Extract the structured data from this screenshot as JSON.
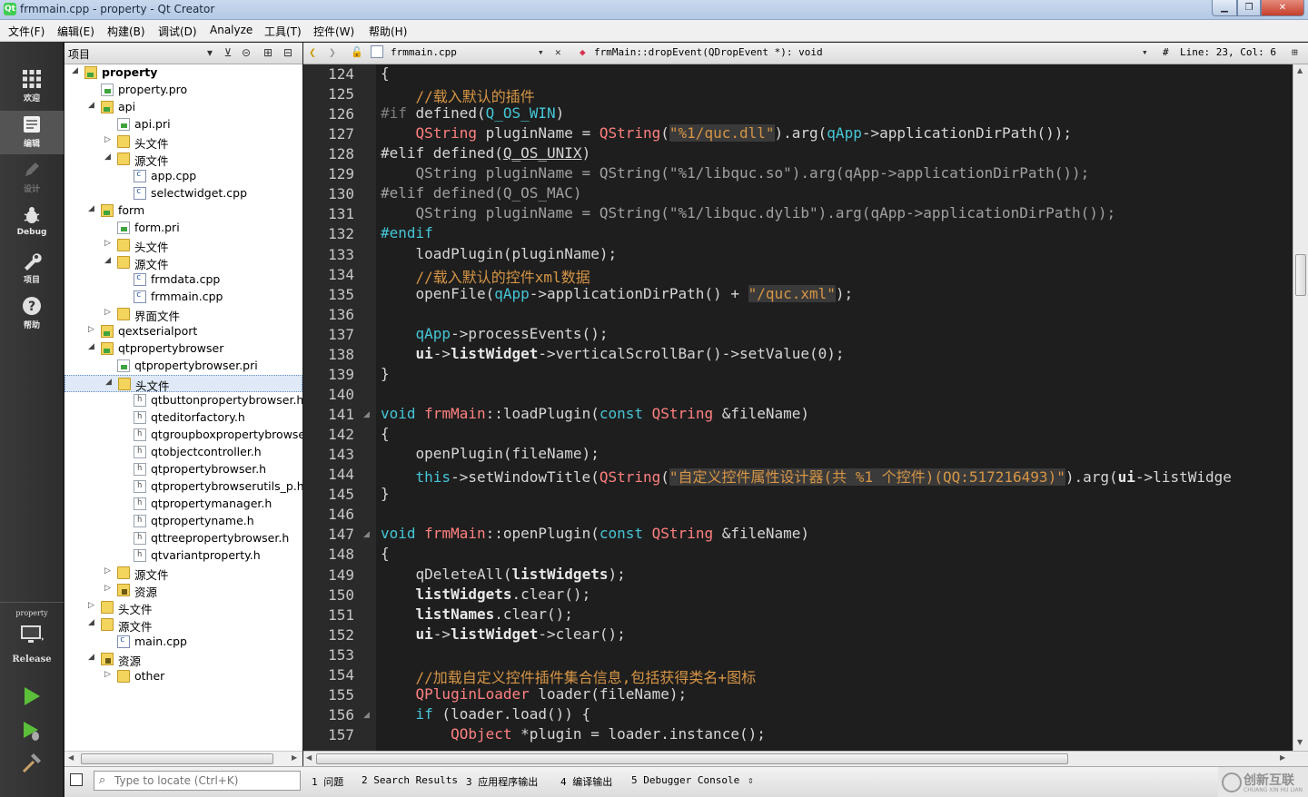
{
  "window": {
    "title": "frmmain.cpp - property - Qt Creator",
    "minimize": "▁",
    "maximize": "❐",
    "close": "✕"
  },
  "menu": [
    "文件(F)",
    "编辑(E)",
    "构建(B)",
    "调试(D)",
    "Analyze",
    "工具(T)",
    "控件(W)",
    "帮助(H)"
  ],
  "modes": [
    {
      "label": "欢迎",
      "icon": "grid-icon"
    },
    {
      "label": "编辑",
      "icon": "edit-icon"
    },
    {
      "label": "设计",
      "icon": "pencil-icon"
    },
    {
      "label": "Debug",
      "icon": "bug-icon"
    },
    {
      "label": "项目",
      "icon": "wrench-icon"
    },
    {
      "label": "帮助",
      "icon": "help-icon"
    }
  ],
  "kit": {
    "project": "property",
    "config": "Release"
  },
  "project_panel": {
    "title": "项目"
  },
  "tree": [
    {
      "label": "property",
      "icon": "projfolder",
      "depth": 0,
      "tw": "◢",
      "bold": true
    },
    {
      "label": "property.pro",
      "icon": "pro",
      "depth": 1,
      "tw": ""
    },
    {
      "label": "api",
      "icon": "projfolder",
      "depth": 1,
      "tw": "◢"
    },
    {
      "label": "api.pri",
      "icon": "pro",
      "depth": 2,
      "tw": ""
    },
    {
      "label": "头文件",
      "icon": "folder",
      "depth": 2,
      "tw": "▷"
    },
    {
      "label": "源文件",
      "icon": "folder",
      "depth": 2,
      "tw": "◢"
    },
    {
      "label": "app.cpp",
      "icon": "cfile",
      "depth": 3,
      "tw": ""
    },
    {
      "label": "selectwidget.cpp",
      "icon": "cfile",
      "depth": 3,
      "tw": ""
    },
    {
      "label": "form",
      "icon": "projfolder",
      "depth": 1,
      "tw": "◢"
    },
    {
      "label": "form.pri",
      "icon": "pro",
      "depth": 2,
      "tw": ""
    },
    {
      "label": "头文件",
      "icon": "folder",
      "depth": 2,
      "tw": "▷"
    },
    {
      "label": "源文件",
      "icon": "folder",
      "depth": 2,
      "tw": "◢"
    },
    {
      "label": "frmdata.cpp",
      "icon": "cfile",
      "depth": 3,
      "tw": ""
    },
    {
      "label": "frmmain.cpp",
      "icon": "cfile",
      "depth": 3,
      "tw": ""
    },
    {
      "label": "界面文件",
      "icon": "folder",
      "depth": 2,
      "tw": "▷"
    },
    {
      "label": "qextserialport",
      "icon": "projfolder",
      "depth": 1,
      "tw": "▷"
    },
    {
      "label": "qtpropertybrowser",
      "icon": "projfolder",
      "depth": 1,
      "tw": "◢"
    },
    {
      "label": "qtpropertybrowser.pri",
      "icon": "pro",
      "depth": 2,
      "tw": ""
    },
    {
      "label": "头文件",
      "icon": "folder",
      "depth": 2,
      "tw": "◢",
      "selected": true
    },
    {
      "label": "qtbuttonpropertybrowser.h",
      "icon": "hfile",
      "depth": 3,
      "tw": ""
    },
    {
      "label": "qteditorfactory.h",
      "icon": "hfile",
      "depth": 3,
      "tw": ""
    },
    {
      "label": "qtgroupboxpropertybrowse",
      "icon": "hfile",
      "depth": 3,
      "tw": ""
    },
    {
      "label": "qtobjectcontroller.h",
      "icon": "hfile",
      "depth": 3,
      "tw": ""
    },
    {
      "label": "qtpropertybrowser.h",
      "icon": "hfile",
      "depth": 3,
      "tw": ""
    },
    {
      "label": "qtpropertybrowserutils_p.h",
      "icon": "hfile",
      "depth": 3,
      "tw": ""
    },
    {
      "label": "qtpropertymanager.h",
      "icon": "hfile",
      "depth": 3,
      "tw": ""
    },
    {
      "label": "qtpropertyname.h",
      "icon": "hfile",
      "depth": 3,
      "tw": ""
    },
    {
      "label": "qttreepropertybrowser.h",
      "icon": "hfile",
      "depth": 3,
      "tw": ""
    },
    {
      "label": "qtvariantproperty.h",
      "icon": "hfile",
      "depth": 3,
      "tw": ""
    },
    {
      "label": "源文件",
      "icon": "folder",
      "depth": 2,
      "tw": "▷"
    },
    {
      "label": "资源",
      "icon": "res",
      "depth": 2,
      "tw": "▷"
    },
    {
      "label": "头文件",
      "icon": "folder",
      "depth": 1,
      "tw": "▷"
    },
    {
      "label": "源文件",
      "icon": "folder",
      "depth": 1,
      "tw": "◢"
    },
    {
      "label": "main.cpp",
      "icon": "cfile",
      "depth": 2,
      "tw": ""
    },
    {
      "label": "资源",
      "icon": "res",
      "depth": 1,
      "tw": "◢"
    },
    {
      "label": "other",
      "icon": "folder",
      "depth": 2,
      "tw": "▷"
    }
  ],
  "editor": {
    "file": "frmmain.cpp",
    "symbol": "frmMain::dropEvent(QDropEvent *): void",
    "hash": "#",
    "position": "Line: 23, Col: 6"
  },
  "line_numbers": [
    "124",
    "125",
    "126",
    "127",
    "128",
    "129",
    "130",
    "131",
    "132",
    "133",
    "134",
    "135",
    "136",
    "137",
    "138",
    "139",
    "140",
    "141",
    "142",
    "143",
    "144",
    "145",
    "146",
    "147",
    "148",
    "149",
    "150",
    "151",
    "152",
    "153",
    "154",
    "155",
    "156",
    "157"
  ],
  "fold_lines": [
    "141",
    "147",
    "156"
  ],
  "code_lines": [
    "{",
    "    //载入默认的插件",
    "#if defined(Q_OS_WIN)",
    "    QString pluginName = QString(\"%1/quc.dll\").arg(qApp->applicationDirPath());",
    "#elif defined(Q_OS_UNIX)",
    "    QString pluginName = QString(\"%1/libquc.so\").arg(qApp->applicationDirPath());",
    "#elif defined(Q_OS_MAC)",
    "    QString pluginName = QString(\"%1/libquc.dylib\").arg(qApp->applicationDirPath());",
    "#endif",
    "    loadPlugin(pluginName);",
    "    //载入默认的控件xml数据",
    "    openFile(qApp->applicationDirPath() + \"/quc.xml\");",
    "",
    "    qApp->processEvents();",
    "    ui->listWidget->verticalScrollBar()->setValue(0);",
    "}",
    "",
    "void frmMain::loadPlugin(const QString &fileName)",
    "{",
    "    openPlugin(fileName);",
    "    this->setWindowTitle(QString(\"自定义控件属性设计器(共 %1 个控件)(QQ:517216493)\").arg(ui->listWidge",
    "}",
    "",
    "void frmMain::openPlugin(const QString &fileName)",
    "{",
    "    qDeleteAll(listWidgets);",
    "    listWidgets.clear();",
    "    listNames.clear();",
    "    ui->listWidget->clear();",
    "",
    "    //加载自定义控件插件集合信息,包括获得类名+图标",
    "    QPluginLoader loader(fileName);",
    "    if (loader.load()) {",
    "        QObject *plugin = loader.instance();"
  ],
  "locator": {
    "placeholder": "Type to locate (Ctrl+K)"
  },
  "output_tabs": [
    "1  问题",
    "2  Search Results",
    "3  应用程序输出",
    "4  编译输出",
    "5  Debugger Console"
  ],
  "watermark": {
    "text": "创新互联",
    "sub": "CHUANG XIN HU LIAN"
  },
  "colors": {
    "keyword": "#45c6d6",
    "type": "#ff8080",
    "string": "#d69545",
    "comment": "#d69545",
    "preproc": "#7d7d7d",
    "member": "#ff6aad"
  }
}
